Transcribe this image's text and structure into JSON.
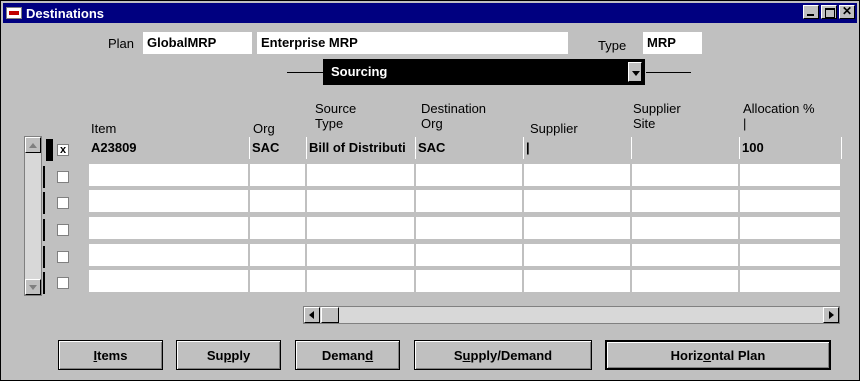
{
  "window": {
    "title": "Destinations"
  },
  "header": {
    "plan_label": "Plan",
    "plan_value": "GlobalMRP",
    "plan_desc": "Enterprise MRP",
    "type_label": "Type",
    "type_value": "MRP",
    "view_select": "Sourcing"
  },
  "columns": {
    "item": "Item",
    "org": "Org",
    "source_type": "Source\nType",
    "dest_org": "Destination\nOrg",
    "supplier": "Supplier",
    "supplier_site": "Supplier\nSite",
    "allocation": "Allocation %\n|"
  },
  "rows": [
    {
      "checked": "x",
      "item": "A23809",
      "org": "SAC",
      "source_type": "Bill of Distributi",
      "dest_org": "SAC",
      "supplier": "|",
      "supplier_site": "",
      "allocation": "100"
    },
    {
      "checked": "",
      "item": "",
      "org": "",
      "source_type": "",
      "dest_org": "",
      "supplier": "",
      "supplier_site": "",
      "allocation": ""
    },
    {
      "checked": "",
      "item": "",
      "org": "",
      "source_type": "",
      "dest_org": "",
      "supplier": "",
      "supplier_site": "",
      "allocation": ""
    },
    {
      "checked": "",
      "item": "",
      "org": "",
      "source_type": "",
      "dest_org": "",
      "supplier": "",
      "supplier_site": "",
      "allocation": ""
    },
    {
      "checked": "",
      "item": "",
      "org": "",
      "source_type": "",
      "dest_org": "",
      "supplier": "",
      "supplier_site": "",
      "allocation": ""
    },
    {
      "checked": "",
      "item": "",
      "org": "",
      "source_type": "",
      "dest_org": "",
      "supplier": "",
      "supplier_site": "",
      "allocation": ""
    }
  ],
  "buttons": {
    "items": {
      "pre": "",
      "u": "I",
      "post": "tems"
    },
    "supply": {
      "pre": "Su",
      "u": "p",
      "post": "ply"
    },
    "demand": {
      "pre": "Deman",
      "u": "d",
      "post": ""
    },
    "supply_demand": {
      "pre": "S",
      "u": "u",
      "post": "pply/Demand"
    },
    "horizontal_plan": {
      "pre": "Horiz",
      "u": "o",
      "post": "ntal Plan"
    }
  }
}
